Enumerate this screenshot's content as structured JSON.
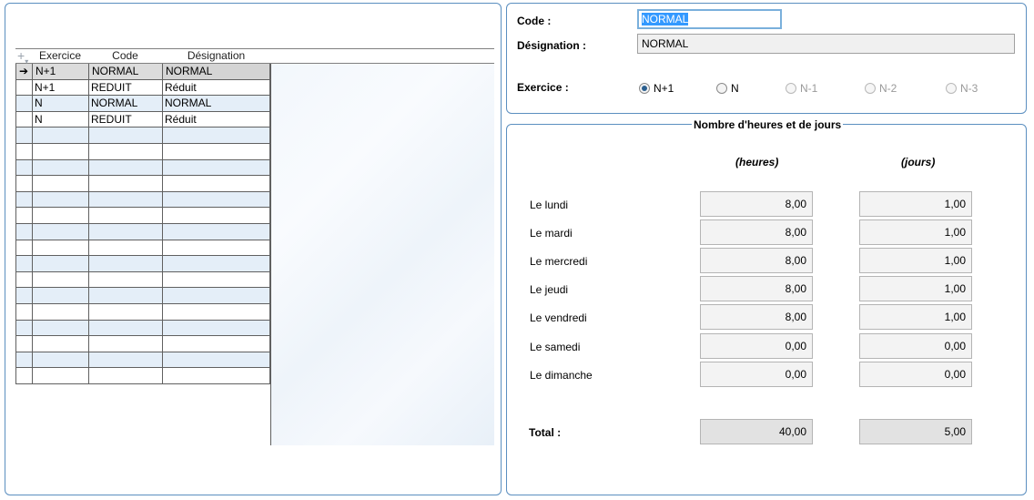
{
  "grid": {
    "add_icon": "plus-icon",
    "columns": {
      "exercice": "Exercice",
      "code": "Code",
      "designation": "Désignation"
    },
    "rows": [
      {
        "indicator": "➔",
        "exercice": "N+1",
        "code": "NORMAL",
        "designation": "NORMAL"
      },
      {
        "indicator": "",
        "exercice": "N+1",
        "code": "REDUIT",
        "designation": "Réduit"
      },
      {
        "indicator": "",
        "exercice": "N",
        "code": "NORMAL",
        "designation": "NORMAL"
      },
      {
        "indicator": "",
        "exercice": "N",
        "code": "REDUIT",
        "designation": "Réduit"
      }
    ]
  },
  "form": {
    "code_label": "Code :",
    "code_value": "NORMAL",
    "designation_label": "Désignation :",
    "designation_value": "NORMAL",
    "exercice_label": "Exercice :",
    "exercice_options": [
      {
        "label": "N+1",
        "selected": true,
        "enabled": true
      },
      {
        "label": "N",
        "selected": false,
        "enabled": true
      },
      {
        "label": "N-1",
        "selected": false,
        "enabled": false
      },
      {
        "label": "N-2",
        "selected": false,
        "enabled": false
      },
      {
        "label": "N-3",
        "selected": false,
        "enabled": false
      }
    ]
  },
  "schedule": {
    "title": "Nombre d'heures et de jours",
    "col_hours": "(heures)",
    "col_days": "(jours)",
    "days": [
      {
        "label": "Le lundi",
        "hours": "8,00",
        "days": "1,00"
      },
      {
        "label": "Le mardi",
        "hours": "8,00",
        "days": "1,00"
      },
      {
        "label": "Le mercredi",
        "hours": "8,00",
        "days": "1,00"
      },
      {
        "label": "Le jeudi",
        "hours": "8,00",
        "days": "1,00"
      },
      {
        "label": "Le vendredi",
        "hours": "8,00",
        "days": "1,00"
      },
      {
        "label": "Le samedi",
        "hours": "0,00",
        "days": "0,00"
      },
      {
        "label": "Le dimanche",
        "hours": "0,00",
        "days": "0,00"
      }
    ],
    "total_label": "Total :",
    "total_hours": "40,00",
    "total_days": "5,00"
  },
  "colors": {
    "panel_border": "#5b8fc0",
    "row_alt": "#e4eef8",
    "selection": "#3399ff"
  }
}
